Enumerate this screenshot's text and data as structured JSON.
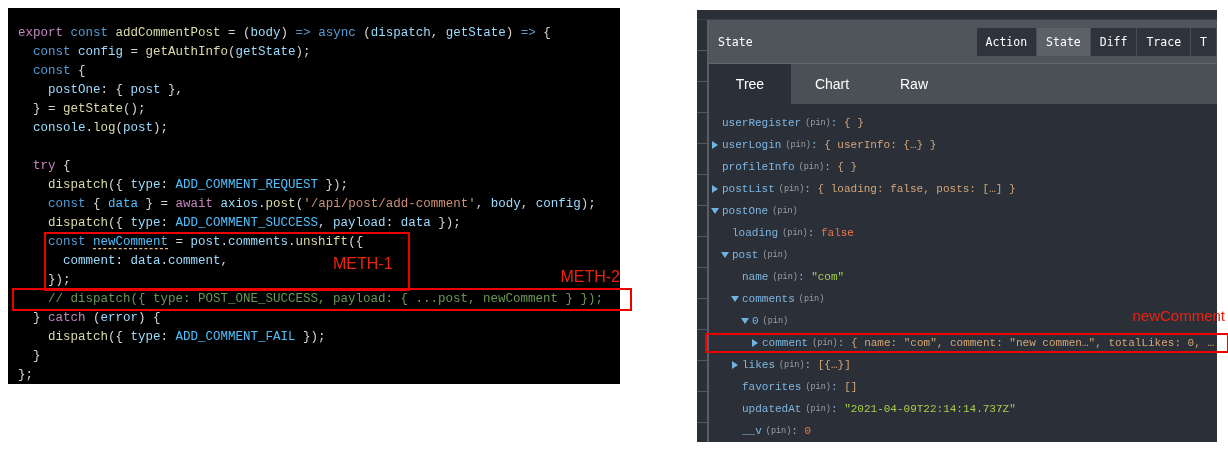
{
  "code_editor": {
    "blocks": [
      {
        "lines": [
          {
            "tokens": [
              {
                "kind": "ctl",
                "text": "export"
              },
              {
                "kind": "kw",
                "text": " const"
              },
              {
                "kind": "fn",
                "text": " addCommentPost"
              },
              {
                "kind": "p",
                "text": " = ("
              },
              {
                "kind": "var",
                "text": "body"
              },
              {
                "kind": "p",
                "text": ") "
              },
              {
                "kind": "kw",
                "text": "=>"
              },
              {
                "kind": "kw",
                "text": " async"
              },
              {
                "kind": "p",
                "text": " ("
              },
              {
                "kind": "var",
                "text": "dispatch"
              },
              {
                "kind": "p",
                "text": ", "
              },
              {
                "kind": "var",
                "text": "getState"
              },
              {
                "kind": "p",
                "text": ") "
              },
              {
                "kind": "kw",
                "text": "=>"
              },
              {
                "kind": "p",
                "text": " {"
              }
            ]
          },
          {
            "tokens": [
              {
                "kind": "kw",
                "text": "  const"
              },
              {
                "kind": "var",
                "text": " config"
              },
              {
                "kind": "p",
                "text": " = "
              },
              {
                "kind": "fn",
                "text": "getAuthInfo"
              },
              {
                "kind": "p",
                "text": "("
              },
              {
                "kind": "var",
                "text": "getState"
              },
              {
                "kind": "p",
                "text": ");"
              }
            ]
          },
          {
            "tokens": [
              {
                "kind": "kw",
                "text": "  const"
              },
              {
                "kind": "p",
                "text": " {"
              }
            ]
          },
          {
            "tokens": [
              {
                "kind": "var",
                "text": "    postOne"
              },
              {
                "kind": "p",
                "text": ": { "
              },
              {
                "kind": "var",
                "text": "post"
              },
              {
                "kind": "p",
                "text": " },"
              }
            ]
          },
          {
            "tokens": [
              {
                "kind": "p",
                "text": "  } = "
              },
              {
                "kind": "fn",
                "text": "getState"
              },
              {
                "kind": "p",
                "text": "();"
              }
            ]
          },
          {
            "tokens": [
              {
                "kind": "var",
                "text": "  console"
              },
              {
                "kind": "p",
                "text": "."
              },
              {
                "kind": "fn",
                "text": "log"
              },
              {
                "kind": "p",
                "text": "("
              },
              {
                "kind": "var",
                "text": "post"
              },
              {
                "kind": "p",
                "text": ");"
              }
            ]
          },
          {
            "blank_before": true,
            "tokens": [
              {
                "kind": "ctl",
                "text": "  try"
              },
              {
                "kind": "p",
                "text": " {"
              }
            ]
          },
          {
            "tokens": [
              {
                "kind": "fn",
                "text": "    dispatch"
              },
              {
                "kind": "p",
                "text": "({ "
              },
              {
                "kind": "var",
                "text": "type"
              },
              {
                "kind": "p",
                "text": ": "
              },
              {
                "kind": "const",
                "text": "ADD_COMMENT_REQUEST"
              },
              {
                "kind": "p",
                "text": " });"
              }
            ]
          },
          {
            "tokens": [
              {
                "kind": "kw",
                "text": "    const"
              },
              {
                "kind": "p",
                "text": " { "
              },
              {
                "kind": "const",
                "text": "data"
              },
              {
                "kind": "p",
                "text": " } = "
              },
              {
                "kind": "ctl",
                "text": "await"
              },
              {
                "kind": "var",
                "text": " axios"
              },
              {
                "kind": "p",
                "text": "."
              },
              {
                "kind": "fn",
                "text": "post"
              },
              {
                "kind": "p",
                "text": "("
              },
              {
                "kind": "str",
                "text": "'/api/post/add-comment'"
              },
              {
                "kind": "p",
                "text": ", "
              },
              {
                "kind": "var",
                "text": "body"
              },
              {
                "kind": "p",
                "text": ", "
              },
              {
                "kind": "var",
                "text": "config"
              },
              {
                "kind": "p",
                "text": ");"
              }
            ]
          },
          {
            "tokens": [
              {
                "kind": "fn",
                "text": "    dispatch"
              },
              {
                "kind": "p",
                "text": "({ "
              },
              {
                "kind": "var",
                "text": "type"
              },
              {
                "kind": "p",
                "text": ": "
              },
              {
                "kind": "const",
                "text": "ADD_COMMENT_SUCCESS"
              },
              {
                "kind": "p",
                "text": ", "
              },
              {
                "kind": "var",
                "text": "payload"
              },
              {
                "kind": "p",
                "text": ": "
              },
              {
                "kind": "var",
                "text": "data"
              },
              {
                "kind": "p",
                "text": " });"
              }
            ]
          }
        ]
      },
      {
        "highlight": {
          "kind": "inset",
          "label": "METH-1"
        },
        "lines": [
          {
            "tokens": [
              {
                "kind": "kw",
                "text": "    const "
              },
              {
                "kind": "const",
                "text": "newComment",
                "warning": true
              },
              {
                "kind": "p",
                "text": " = "
              },
              {
                "kind": "var",
                "text": "post"
              },
              {
                "kind": "p",
                "text": "."
              },
              {
                "kind": "var",
                "text": "comments"
              },
              {
                "kind": "p",
                "text": "."
              },
              {
                "kind": "fn",
                "text": "unshift"
              },
              {
                "kind": "p",
                "text": "({"
              }
            ]
          },
          {
            "tokens": [
              {
                "kind": "var",
                "text": "      comment"
              },
              {
                "kind": "p",
                "text": ": "
              },
              {
                "kind": "var",
                "text": "data"
              },
              {
                "kind": "p",
                "text": "."
              },
              {
                "kind": "var",
                "text": "comment"
              },
              {
                "kind": "p",
                "text": ","
              }
            ]
          },
          {
            "tokens": [
              {
                "kind": "p",
                "text": "    });"
              }
            ]
          }
        ]
      },
      {
        "highlight": {
          "kind": "full",
          "label": "METH-2"
        },
        "lines": [
          {
            "tokens": [
              {
                "kind": "cmt",
                "text": "    // dispatch({ type: POST_ONE_SUCCESS, payload: { ...post, newComment } });"
              }
            ]
          }
        ]
      },
      {
        "lines": [
          {
            "tokens": [
              {
                "kind": "p",
                "text": "  } "
              },
              {
                "kind": "ctl",
                "text": "catch"
              },
              {
                "kind": "p",
                "text": " ("
              },
              {
                "kind": "var",
                "text": "error"
              },
              {
                "kind": "p",
                "text": ") {"
              }
            ]
          },
          {
            "tokens": [
              {
                "kind": "fn",
                "text": "    dispatch"
              },
              {
                "kind": "p",
                "text": "({ "
              },
              {
                "kind": "var",
                "text": "type"
              },
              {
                "kind": "p",
                "text": ": "
              },
              {
                "kind": "const",
                "text": "ADD_COMMENT_FAIL"
              },
              {
                "kind": "p",
                "text": " });"
              }
            ]
          },
          {
            "tokens": [
              {
                "kind": "p",
                "text": "  }"
              }
            ]
          },
          {
            "tokens": [
              {
                "kind": "p",
                "text": "};"
              }
            ]
          }
        ]
      }
    ]
  },
  "devtools": {
    "header_title": "State",
    "modes": [
      {
        "label": "Action",
        "selected": false
      },
      {
        "label": "State",
        "selected": true
      },
      {
        "label": "Diff",
        "selected": false
      },
      {
        "label": "Trace",
        "selected": false
      },
      {
        "label": "T",
        "selected": false
      }
    ],
    "tabs": [
      {
        "label": "Tree",
        "selected": true
      },
      {
        "label": "Chart",
        "selected": false
      },
      {
        "label": "Raw",
        "selected": false
      }
    ],
    "tree": [
      {
        "key": "userRegister",
        "pin": "(pin)",
        "kind": "leaf",
        "value": [
          {
            "kind": "sep",
            "text": ": "
          },
          {
            "kind": "obj",
            "text": "{ }"
          }
        ]
      },
      {
        "key": "userLogin",
        "pin": "(pin)",
        "kind": "branch",
        "expanded": false,
        "value": [
          {
            "kind": "sep",
            "text": ": "
          },
          {
            "kind": "obj",
            "text": "{ userInfo: {…} }"
          }
        ]
      },
      {
        "key": "profileInfo",
        "pin": "(pin)",
        "kind": "leaf",
        "value": [
          {
            "kind": "sep",
            "text": ": "
          },
          {
            "kind": "obj",
            "text": "{ }"
          }
        ]
      },
      {
        "key": "postList",
        "pin": "(pin)",
        "kind": "branch",
        "expanded": false,
        "value": [
          {
            "kind": "sep",
            "text": ": "
          },
          {
            "kind": "obj",
            "text": "{ loading: false, posts: […] }"
          }
        ]
      },
      {
        "key": "postOne",
        "pin": "(pin)",
        "kind": "branch",
        "expanded": true,
        "children": [
          {
            "key": "loading",
            "pin": "(pin)",
            "kind": "leaf",
            "value": [
              {
                "kind": "sep",
                "text": ": "
              },
              {
                "kind": "lit",
                "text": "false"
              }
            ]
          },
          {
            "key": "post",
            "pin": "(pin)",
            "kind": "branch",
            "expanded": true,
            "children": [
              {
                "key": "name",
                "pin": "(pin)",
                "kind": "leaf",
                "value": [
                  {
                    "kind": "sep",
                    "text": ": "
                  },
                  {
                    "kind": "str",
                    "text": "\"com\""
                  }
                ]
              },
              {
                "key": "comments",
                "pin": "(pin)",
                "kind": "branch",
                "expanded": true,
                "children": [
                  {
                    "key": "0",
                    "pin": "(pin)",
                    "kind": "branch",
                    "expanded": true,
                    "children": [
                      {
                        "key": "comment",
                        "pin": "(pin)",
                        "kind": "branch",
                        "expanded": false,
                        "highlight": {
                          "label": "newComment"
                        },
                        "value": [
                          {
                            "kind": "sep",
                            "text": ": "
                          },
                          {
                            "kind": "obj",
                            "text": "{ name: \"com\", comment: \"new commen…\", totalLikes: 0, …"
                          }
                        ]
                      }
                    ]
                  }
                ]
              },
              {
                "key": "likes",
                "pin": "(pin)",
                "kind": "branch",
                "expanded": false,
                "value": [
                  {
                    "kind": "sep",
                    "text": ": "
                  },
                  {
                    "kind": "obj",
                    "text": "[{…}]"
                  }
                ]
              },
              {
                "key": "favorites",
                "pin": "(pin)",
                "kind": "leaf",
                "value": [
                  {
                    "kind": "sep",
                    "text": ": "
                  },
                  {
                    "kind": "obj",
                    "text": "[]"
                  }
                ]
              },
              {
                "key": "updatedAt",
                "pin": "(pin)",
                "kind": "leaf",
                "value": [
                  {
                    "kind": "sep",
                    "text": ": "
                  },
                  {
                    "kind": "str",
                    "text": "\"2021-04-09T22:14:14.737Z\""
                  }
                ]
              },
              {
                "key": "__v",
                "pin": "(pin)",
                "kind": "leaf",
                "value": [
                  {
                    "kind": "sep",
                    "text": ": "
                  },
                  {
                    "kind": "lit",
                    "text": "0"
                  }
                ]
              }
            ]
          }
        ]
      }
    ]
  }
}
